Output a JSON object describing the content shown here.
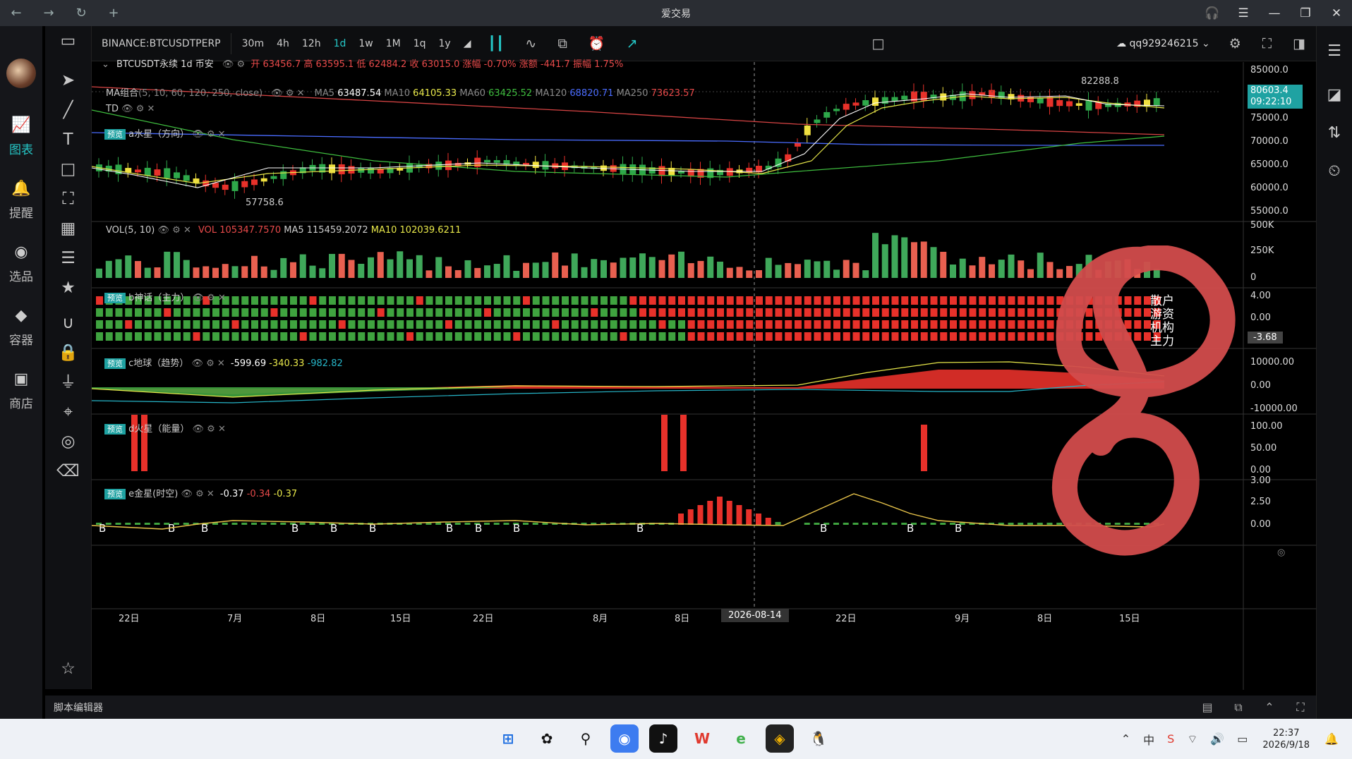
{
  "window": {
    "title": "爱交易"
  },
  "sidebar": [
    {
      "label": "图表",
      "icon": "chart-icon",
      "active": true
    },
    {
      "label": "提醒",
      "icon": "bell-icon"
    },
    {
      "label": "选品",
      "icon": "selector-icon"
    },
    {
      "label": "容器",
      "icon": "container-icon"
    },
    {
      "label": "商店",
      "icon": "store-icon"
    }
  ],
  "toolbar": {
    "symbol": "BINANCE:BTCUSDTPERP",
    "timeframes": [
      "30m",
      "4h",
      "12h",
      "1d",
      "1w",
      "1M",
      "1q",
      "1y"
    ],
    "active_timeframe": "1d",
    "user": "qq929246215"
  },
  "main": {
    "header": "BTCUSDT永续  1d  币安",
    "ohlc": {
      "open": "开 63456.7",
      "high": "高 63595.1",
      "low": "低 62484.2",
      "close": "收 63015.0",
      "chg_pct": "涨幅 -0.70%",
      "chg": "涨额 -441.7",
      "amp": "振幅 1.75%"
    },
    "ma_label": "MA组合",
    "ma_params": "(5, 10, 60, 120, 250, close)",
    "ma_values": [
      {
        "name": "MA5",
        "value": "63487.54",
        "color": "#ffffff"
      },
      {
        "name": "MA10",
        "value": "64105.33",
        "color": "#e8e84a"
      },
      {
        "name": "MA60",
        "value": "63425.52",
        "color": "#3fbf3f"
      },
      {
        "name": "MA120",
        "value": "68820.71",
        "color": "#4a6cff"
      },
      {
        "name": "MA250",
        "value": "73623.57",
        "color": "#e84a4a"
      }
    ],
    "td_label": "TD",
    "a_label": "a水星（方向）",
    "price_axis": [
      "85000.0",
      "80000.0",
      "75000.0",
      "70000.0",
      "65000.0",
      "60000.0",
      "55000.0"
    ],
    "last_price": "80603.4",
    "countdown": "09:22:10",
    "low_mark": "57758.6",
    "high_mark": "82288.8"
  },
  "vol": {
    "label": "VOL(5, 10)",
    "vol": "VOL 105347.7570",
    "ma5": "MA5 115459.2072",
    "ma10": "MA10 102039.6211",
    "axis": [
      "500K",
      "250K",
      "0"
    ]
  },
  "b": {
    "label": "b神话（主力）",
    "axis": [
      "4.00",
      "0.00"
    ],
    "current": "-3.68",
    "legend": [
      "散户",
      "游资",
      "机构",
      "主力"
    ]
  },
  "c": {
    "label": "c地球（趋势）",
    "v1": "-599.69",
    "v2": "-340.33",
    "v3": "-982.82",
    "axis": [
      "10000.00",
      "0.00",
      "-10000.00"
    ]
  },
  "d": {
    "label": "d火星（能量）",
    "axis": [
      "100.00",
      "50.00",
      "0.00"
    ]
  },
  "e": {
    "label": "e金星(时空)",
    "v1": "-0.37",
    "v2": "-0.34",
    "v3": "-0.37",
    "axis": [
      "3.00",
      "2.50",
      "0.00"
    ]
  },
  "preview_tag": "预览",
  "time_axis": [
    "22日",
    "7月",
    "8日",
    "15日",
    "22日",
    "8月",
    "8日",
    "2026-08-14",
    "22日",
    "9月",
    "8日",
    "15日"
  ],
  "bottom": {
    "script_editor": "脚本编辑器"
  },
  "taskbar": {
    "time": "22:37",
    "date": "2026/9/18"
  }
}
